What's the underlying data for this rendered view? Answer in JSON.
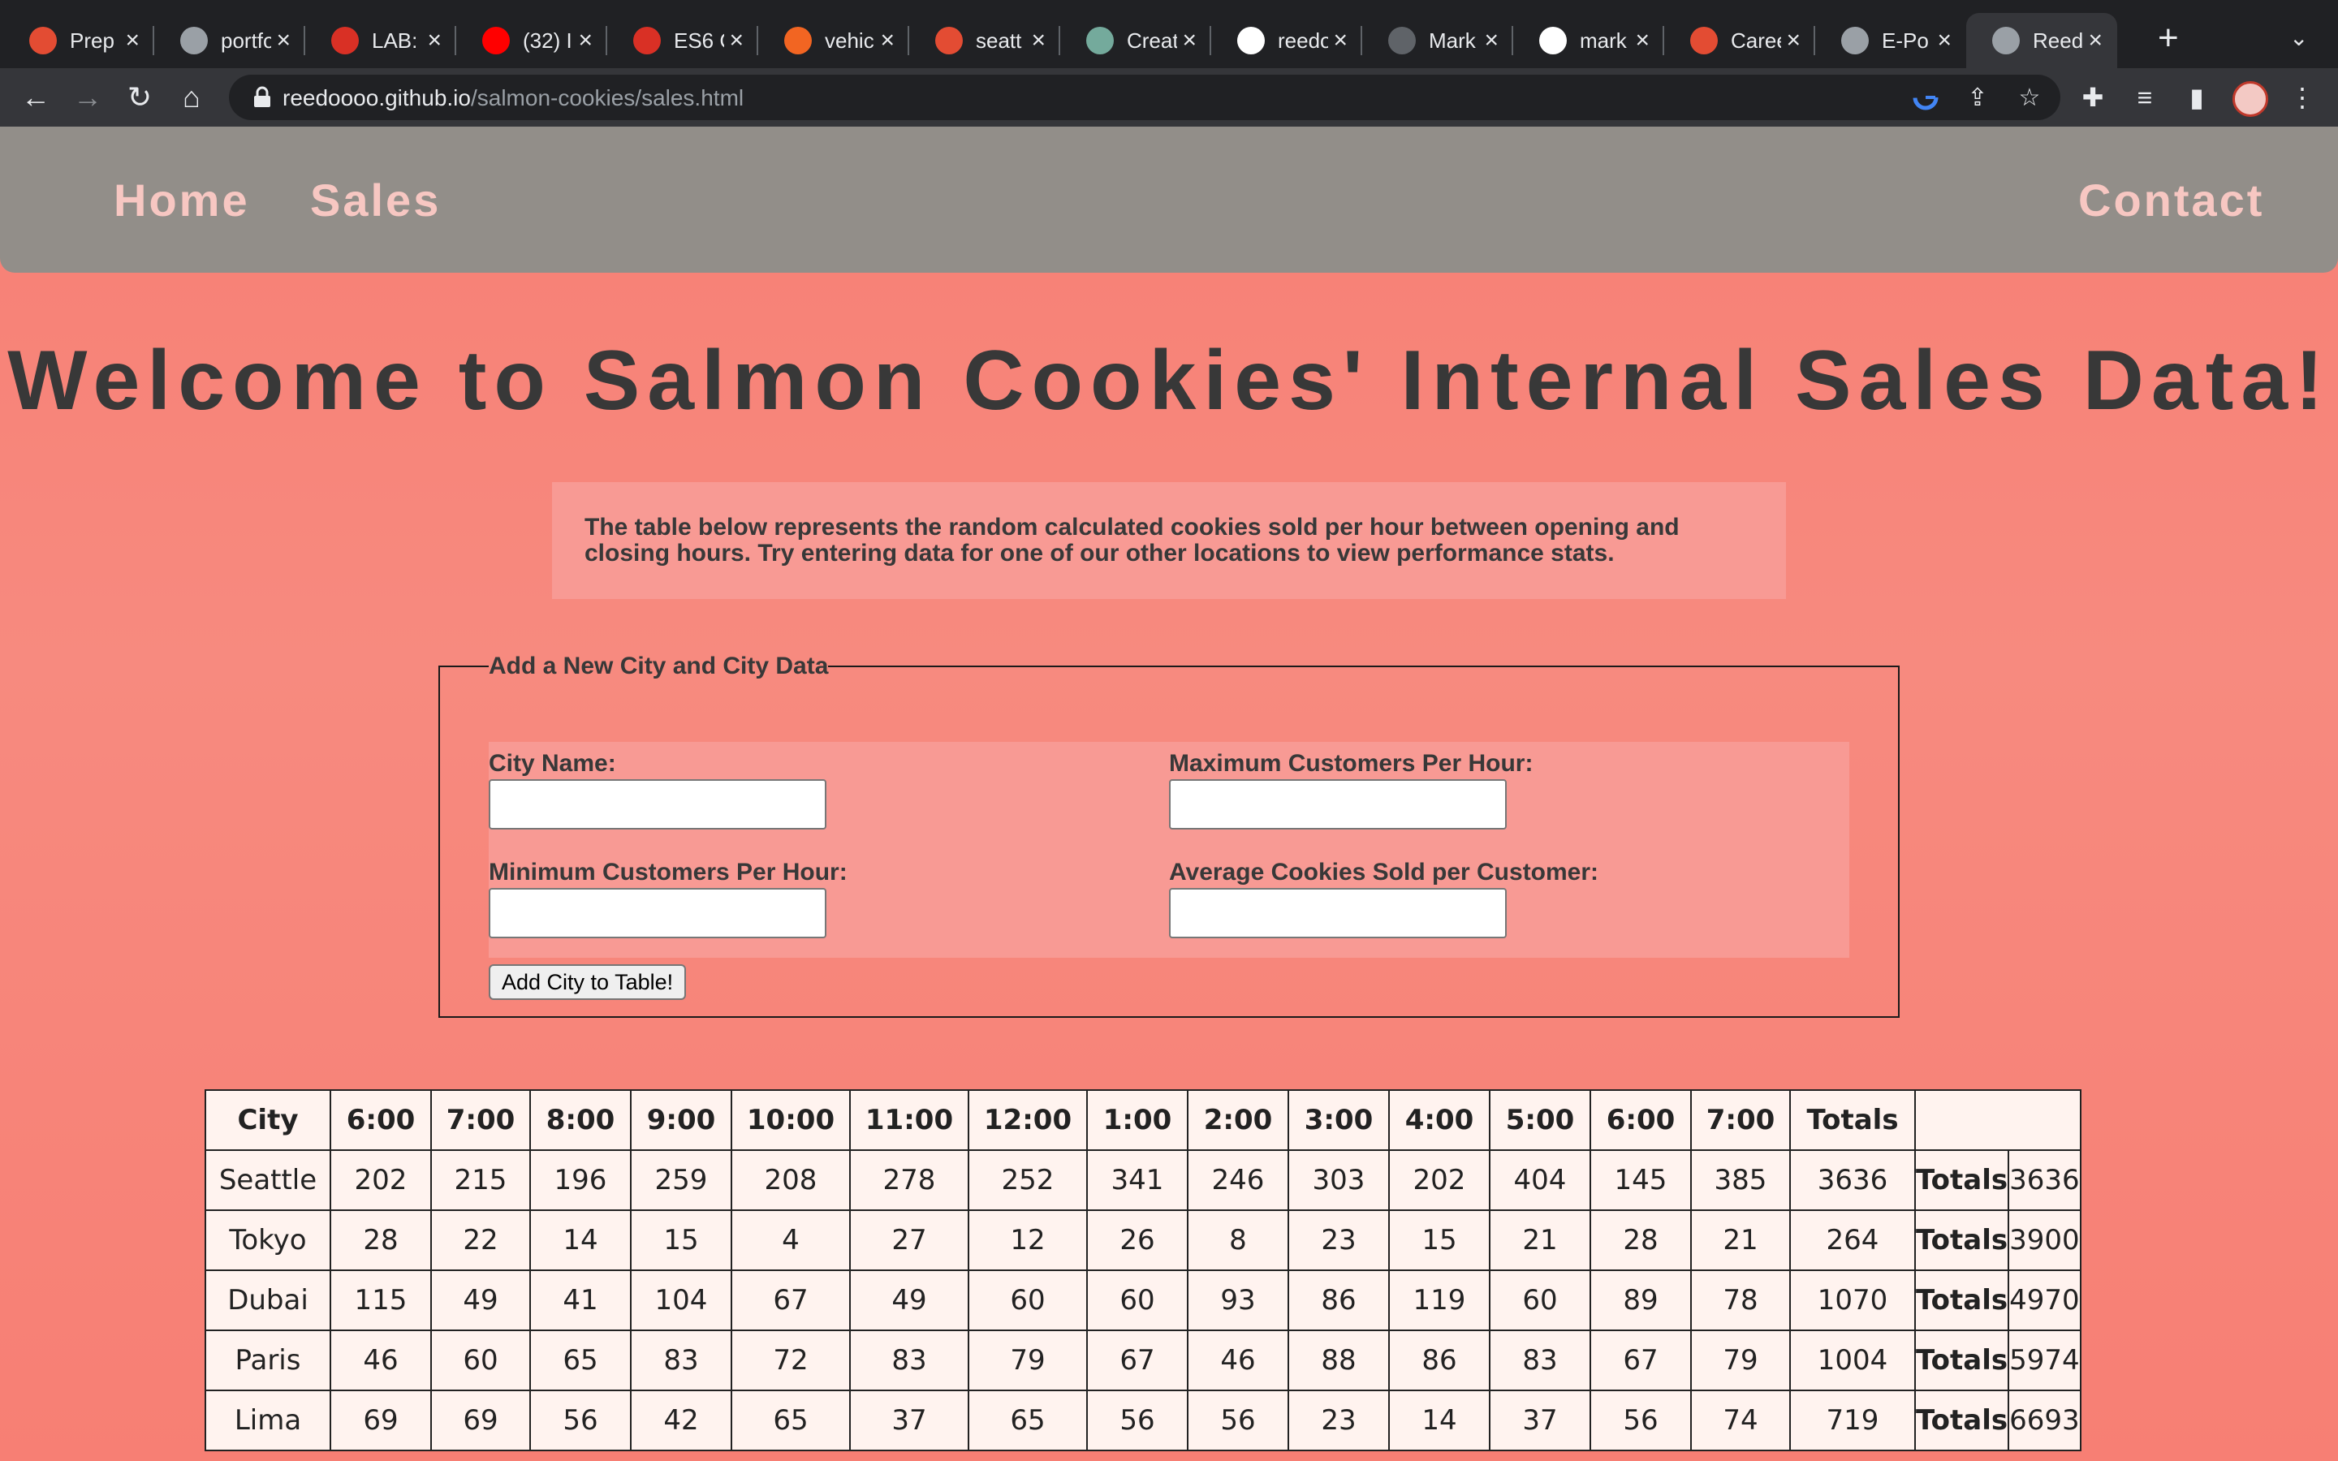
{
  "browser": {
    "tabs": [
      {
        "label": "Prep",
        "favicon_color": "#e34c33"
      },
      {
        "label": "portfo",
        "favicon_color": "#9aa0a6"
      },
      {
        "label": "LAB:",
        "favicon_color": "#d93025"
      },
      {
        "label": "(32) I",
        "favicon_color": "#ff0000"
      },
      {
        "label": "ES6 C",
        "favicon_color": "#d93025"
      },
      {
        "label": "vehic",
        "favicon_color": "#f26522"
      },
      {
        "label": "seatt",
        "favicon_color": "#e34c33"
      },
      {
        "label": "Creat",
        "favicon_color": "#74aa9c"
      },
      {
        "label": "reedo",
        "favicon_color": "#ffffff"
      },
      {
        "label": "Mark",
        "favicon_color": "#5f6368"
      },
      {
        "label": "mark",
        "favicon_color": "#ffffff"
      },
      {
        "label": "Caree",
        "favicon_color": "#e34c33"
      },
      {
        "label": "E-Po",
        "favicon_color": "#9aa0a6"
      },
      {
        "label": "Reed",
        "favicon_color": "#9aa0a6"
      }
    ],
    "active_tab": 13,
    "url_host": "reedoooo.github.io",
    "url_path": "/salmon-cookies/sales.html"
  },
  "nav": {
    "home": "Home",
    "sales": "Sales",
    "contact": "Contact"
  },
  "page": {
    "title": "Welcome to Salmon Cookies' Internal Sales Data!",
    "intro": "The table below represents the random calculated cookies sold per hour between opening and closing hours. Try entering data for one of our other locations to view performance stats."
  },
  "form": {
    "legend": "Add a New City and City Data",
    "city_name_label": "City Name:",
    "max_customers_label": "Maximum Customers Per Hour:",
    "min_customers_label": "Minimum Customers Per Hour:",
    "avg_cookies_label": "Average Cookies Sold per Customer:",
    "city_name_value": "",
    "max_customers_value": "",
    "min_customers_value": "",
    "avg_cookies_value": "",
    "submit_label": "Add City to Table!"
  },
  "table": {
    "headers": [
      "City",
      "6:00",
      "7:00",
      "8:00",
      "9:00",
      "10:00",
      "11:00",
      "12:00",
      "1:00",
      "2:00",
      "3:00",
      "4:00",
      "5:00",
      "6:00",
      "7:00",
      "Totals",
      ""
    ],
    "rows": [
      [
        "Seattle",
        "202",
        "215",
        "196",
        "259",
        "208",
        "278",
        "252",
        "341",
        "246",
        "303",
        "202",
        "404",
        "145",
        "385",
        "3636",
        "Totals",
        "3636"
      ],
      [
        "Tokyo",
        "28",
        "22",
        "14",
        "15",
        "4",
        "27",
        "12",
        "26",
        "8",
        "23",
        "15",
        "21",
        "28",
        "21",
        "264",
        "Totals",
        "3900"
      ],
      [
        "Dubai",
        "115",
        "49",
        "41",
        "104",
        "67",
        "49",
        "60",
        "60",
        "93",
        "86",
        "119",
        "60",
        "89",
        "78",
        "1070",
        "Totals",
        "4970"
      ],
      [
        "Paris",
        "46",
        "60",
        "65",
        "83",
        "72",
        "83",
        "79",
        "67",
        "46",
        "88",
        "86",
        "83",
        "67",
        "79",
        "1004",
        "Totals",
        "5974"
      ],
      [
        "Lima",
        "69",
        "69",
        "56",
        "42",
        "65",
        "37",
        "65",
        "56",
        "56",
        "23",
        "14",
        "37",
        "56",
        "74",
        "719",
        "Totals",
        "6693"
      ]
    ]
  }
}
